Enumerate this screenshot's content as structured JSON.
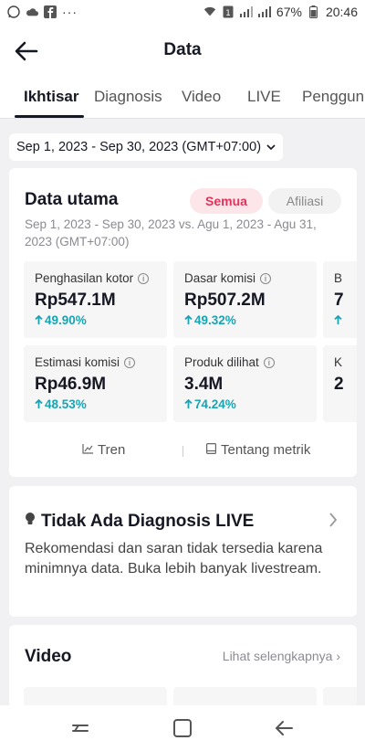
{
  "status_bar": {
    "battery": "67%",
    "time": "20:46"
  },
  "header": {
    "title": "Data"
  },
  "tabs": [
    {
      "label": "Ikhtisar",
      "active": true
    },
    {
      "label": "Diagnosis"
    },
    {
      "label": "Video"
    },
    {
      "label": "LIVE"
    },
    {
      "label": "Penggun"
    }
  ],
  "date_range": {
    "label": "Sep 1, 2023 - Sep 30, 2023 (GMT+07:00)"
  },
  "main_data": {
    "title": "Data utama",
    "filters": [
      {
        "label": "Semua",
        "selected": true
      },
      {
        "label": "Afiliasi"
      }
    ],
    "comparison": "Sep 1, 2023 - Sep 30, 2023 vs. Agu 1, 2023 - Agu 31, 2023 (GMT+07:00)",
    "metrics": [
      {
        "label": "Penghasilan kotor",
        "value": "Rp547.1M",
        "change": "49.90%"
      },
      {
        "label": "Dasar komisi",
        "value": "Rp507.2M",
        "change": "49.32%"
      },
      {
        "label": "B",
        "value": "7",
        "change": ""
      },
      {
        "label": "Estimasi komisi",
        "value": "Rp46.9M",
        "change": "48.53%"
      },
      {
        "label": "Produk dilihat",
        "value": "3.4M",
        "change": "74.24%"
      },
      {
        "label": "K",
        "value": "2",
        "change": ""
      }
    ],
    "links": {
      "trend": "Tren",
      "about": "Tentang metrik"
    }
  },
  "diagnosis": {
    "title": "Tidak Ada Diagnosis LIVE",
    "text": "Rekomendasi dan saran tidak tersedia karena minimnya data. Buka lebih banyak livestream."
  },
  "video": {
    "title": "Video",
    "see_more": "Lihat selengkapnya"
  },
  "colors": {
    "accent_pink": "#e1345b",
    "trend_up": "#1aa3b2"
  }
}
